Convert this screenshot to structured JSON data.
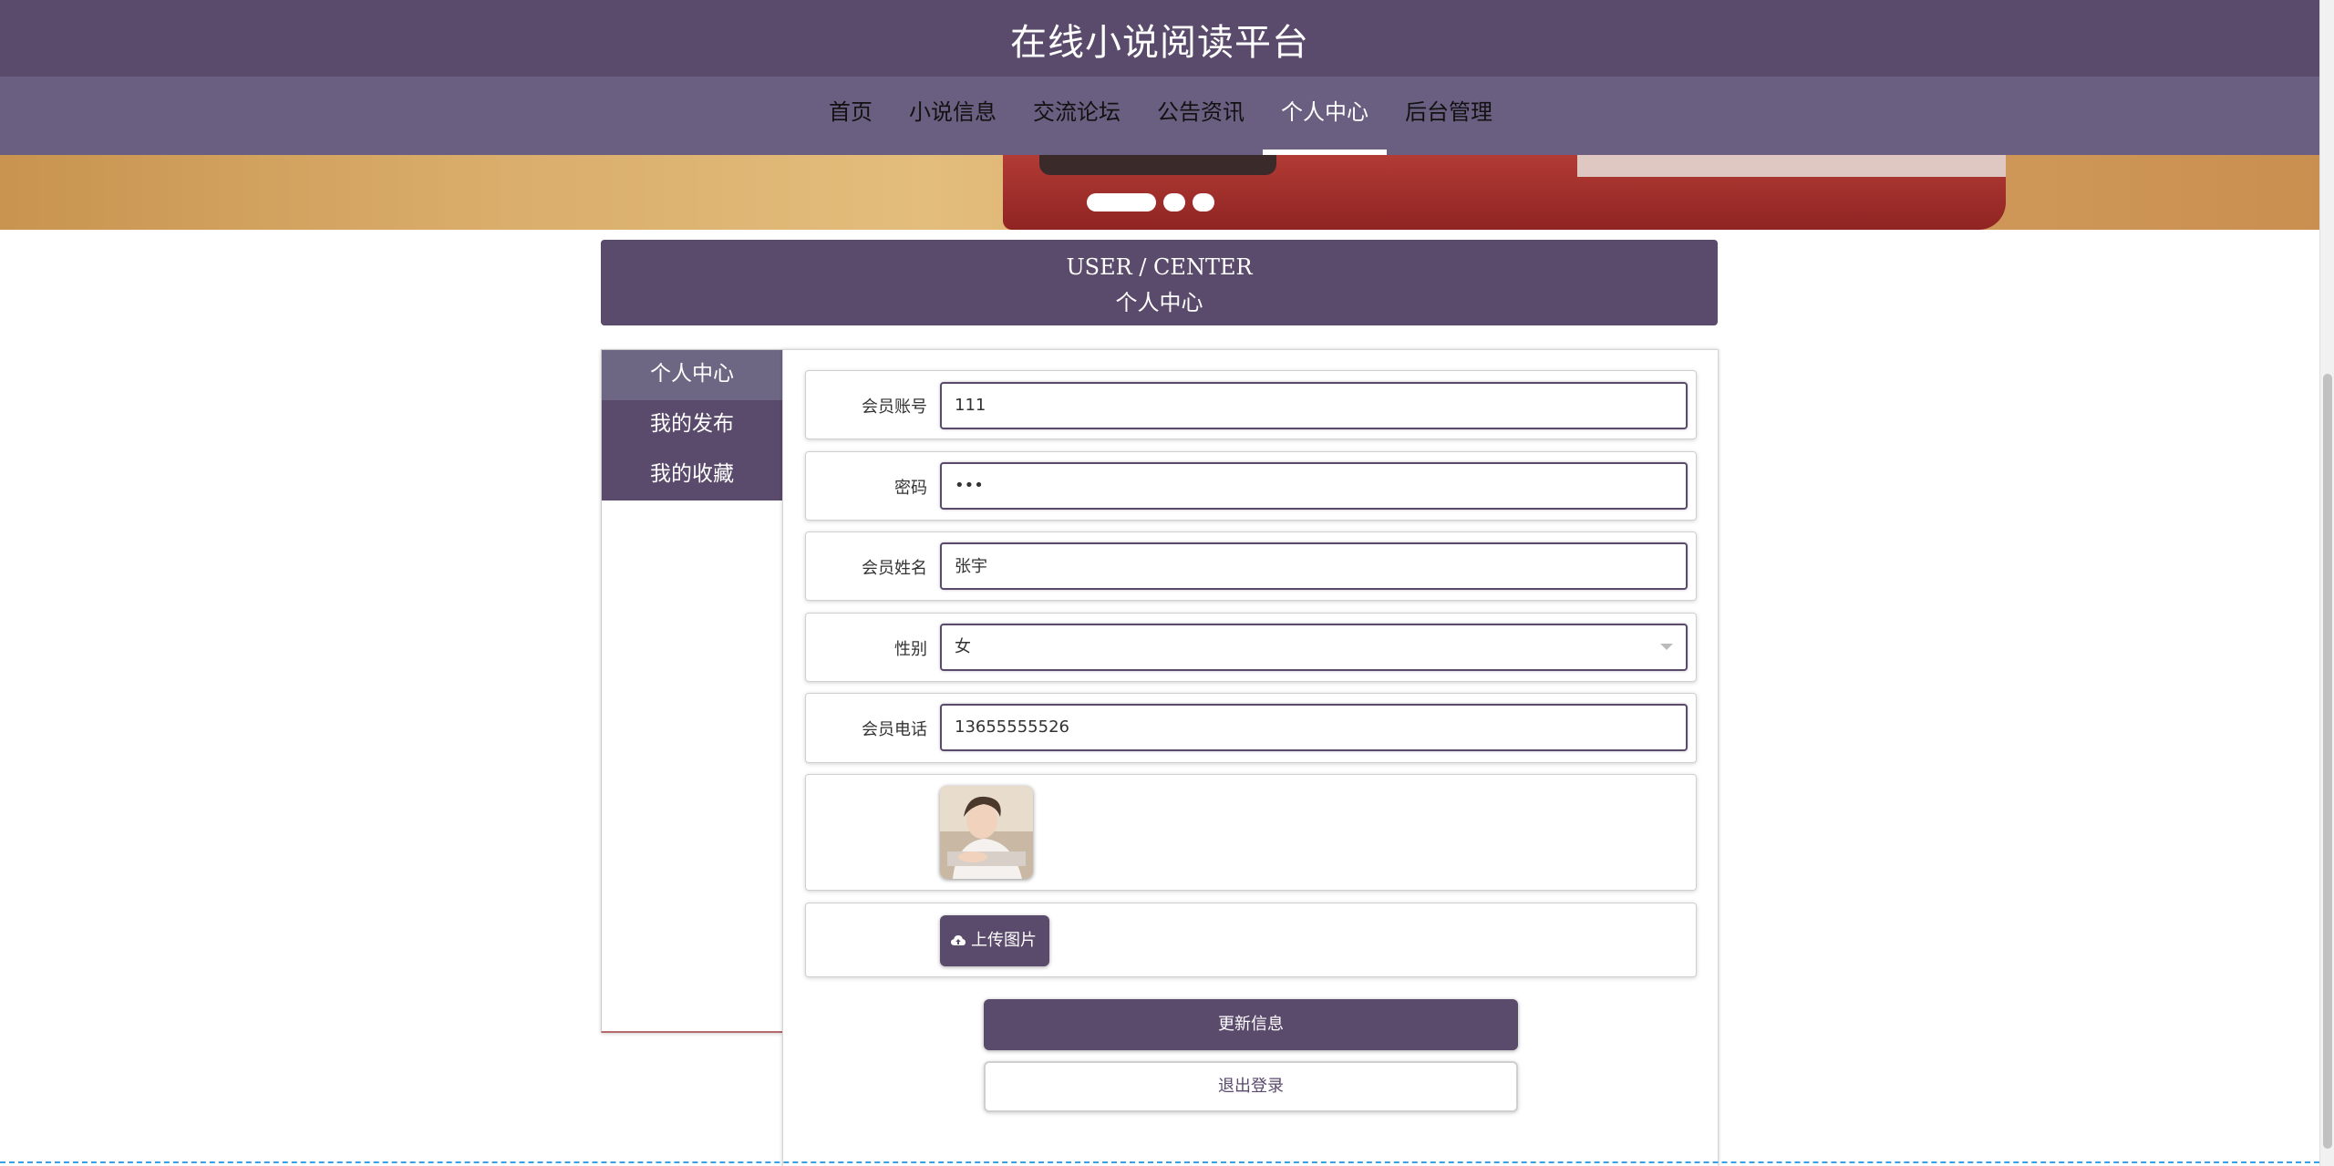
{
  "header": {
    "title": "在线小说阅读平台"
  },
  "nav": {
    "items": [
      {
        "label": "首页"
      },
      {
        "label": "小说信息"
      },
      {
        "label": "交流论坛"
      },
      {
        "label": "公告资讯"
      },
      {
        "label": "个人中心"
      },
      {
        "label": "后台管理"
      }
    ],
    "active_index": 4
  },
  "banner": {
    "slide_count": 3,
    "active_slide": 1
  },
  "section": {
    "title_en": "USER / CENTER",
    "title_cn": "个人中心"
  },
  "sidebar": {
    "items": [
      {
        "label": "个人中心"
      },
      {
        "label": "我的发布"
      },
      {
        "label": "我的收藏"
      }
    ],
    "active_index": 0
  },
  "form": {
    "account": {
      "label": "会员账号",
      "value": "111"
    },
    "password": {
      "label": "密码",
      "value": "•••"
    },
    "name": {
      "label": "会员姓名",
      "value": "张宇"
    },
    "gender": {
      "label": "性别",
      "value": "女"
    },
    "phone": {
      "label": "会员电话",
      "value": "13655555526"
    },
    "upload_label": "上传图片",
    "update_label": "更新信息",
    "logout_label": "退出登录"
  },
  "colors": {
    "primary": "#5a4a6b",
    "nav_bg": "#6a5f80",
    "text": "#333333"
  }
}
